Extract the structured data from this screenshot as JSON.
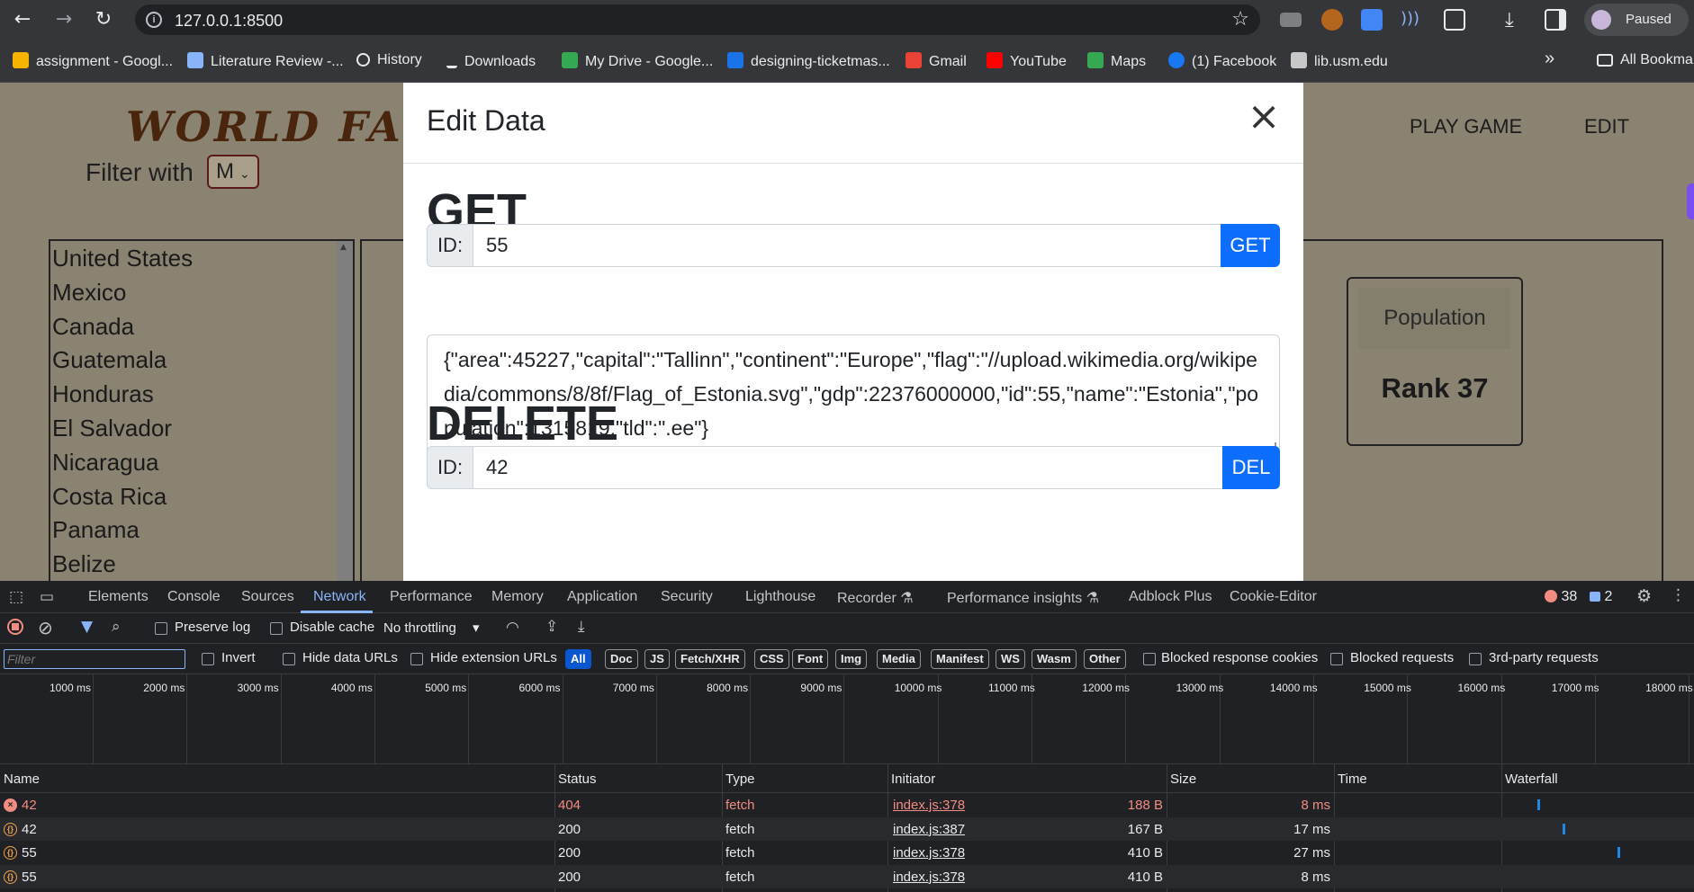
{
  "browser": {
    "url": "127.0.0.1:8500",
    "profile_status": "Paused",
    "bookmarks": [
      {
        "label": "assignment - Googl...",
        "color": "#f4b400"
      },
      {
        "label": "Literature Review -...",
        "color": "#8ab4f8"
      },
      {
        "label": "History",
        "color": "#e8eaed"
      },
      {
        "label": "Downloads",
        "color": "#e8eaed"
      },
      {
        "label": "My Drive - Google...",
        "color": "#34a853"
      },
      {
        "label": "designing-ticketmas...",
        "color": "#1a73e8"
      },
      {
        "label": "Gmail",
        "color": "#ea4335"
      },
      {
        "label": "YouTube",
        "color": "#ff0000"
      },
      {
        "label": "Maps",
        "color": "#34a853"
      },
      {
        "label": "(1) Facebook",
        "color": "#1877f2"
      },
      {
        "label": "lib.usm.edu",
        "color": "#c8c8c8"
      }
    ],
    "bookmarks_more": "»",
    "all_bookmarks": "All Bookma"
  },
  "page": {
    "logo": "WORLD FACT",
    "filter_label": "Filter with",
    "filter_value": "M",
    "nav": {
      "play": "PLAY GAME",
      "edit": "EDIT"
    },
    "countries": [
      "United States",
      "Mexico",
      "Canada",
      "Guatemala",
      "Honduras",
      "El Salvador",
      "Nicaragua",
      "Costa Rica",
      "Panama",
      "Belize"
    ],
    "stat_label": "Population",
    "stat_rank": "Rank 37"
  },
  "modal": {
    "title": "Edit Data",
    "close": "×",
    "get": {
      "heading": "GET",
      "id_label": "ID:",
      "id_value": "55",
      "button": "GET"
    },
    "json_output": "{\"area\":45227,\"capital\":\"Tallinn\",\"continent\":\"Europe\",\"flag\":\"//upload.wikimedia.org/wikipedia/commons/8/8f/Flag_of_Estonia.svg\",\"gdp\":22376000000,\"id\":55,\"name\":\"Estonia\",\"population\":1315819,\"tld\":\".ee\"}",
    "delete": {
      "heading": "DELETE",
      "id_label": "ID:",
      "id_value": "42",
      "button": "DEL"
    }
  },
  "devtools": {
    "tabs": [
      "Elements",
      "Console",
      "Sources",
      "Network",
      "Performance",
      "Memory",
      "Application",
      "Security",
      "Lighthouse",
      "Recorder",
      "Performance insights",
      "Adblock Plus",
      "Cookie-Editor"
    ],
    "active_tab": "Network",
    "error_count": "38",
    "message_count": "2",
    "preserve_log": "Preserve log",
    "disable_cache": "Disable cache",
    "throttling": "No throttling",
    "filter_placeholder": "Filter",
    "invert": "Invert",
    "hide_data_urls": "Hide data URLs",
    "hide_extension_urls": "Hide extension URLs",
    "type_filters": [
      "All",
      "Doc",
      "JS",
      "Fetch/XHR",
      "CSS",
      "Font",
      "Img",
      "Media",
      "Manifest",
      "WS",
      "Wasm",
      "Other"
    ],
    "blocked_cookies": "Blocked response cookies",
    "blocked_requests": "Blocked requests",
    "third_party": "3rd-party requests",
    "timeline_ticks": [
      "1000 ms",
      "2000 ms",
      "3000 ms",
      "4000 ms",
      "5000 ms",
      "6000 ms",
      "7000 ms",
      "8000 ms",
      "9000 ms",
      "10000 ms",
      "11000 ms",
      "12000 ms",
      "13000 ms",
      "14000 ms",
      "15000 ms",
      "16000 ms",
      "17000 ms",
      "18000 ms"
    ],
    "columns": [
      "Name",
      "Status",
      "Type",
      "Initiator",
      "Size",
      "Time",
      "Waterfall"
    ],
    "requests": [
      {
        "name": "42",
        "status": "404",
        "type": "fetch",
        "initiator": "index.js:378",
        "size": "188 B",
        "time": "8 ms",
        "error": true
      },
      {
        "name": "42",
        "status": "200",
        "type": "fetch",
        "initiator": "index.js:387",
        "size": "167 B",
        "time": "17 ms",
        "error": false
      },
      {
        "name": "55",
        "status": "200",
        "type": "fetch",
        "initiator": "index.js:378",
        "size": "410 B",
        "time": "27 ms",
        "error": false
      },
      {
        "name": "55",
        "status": "200",
        "type": "fetch",
        "initiator": "index.js:378",
        "size": "410 B",
        "time": "8 ms",
        "error": false
      }
    ]
  }
}
